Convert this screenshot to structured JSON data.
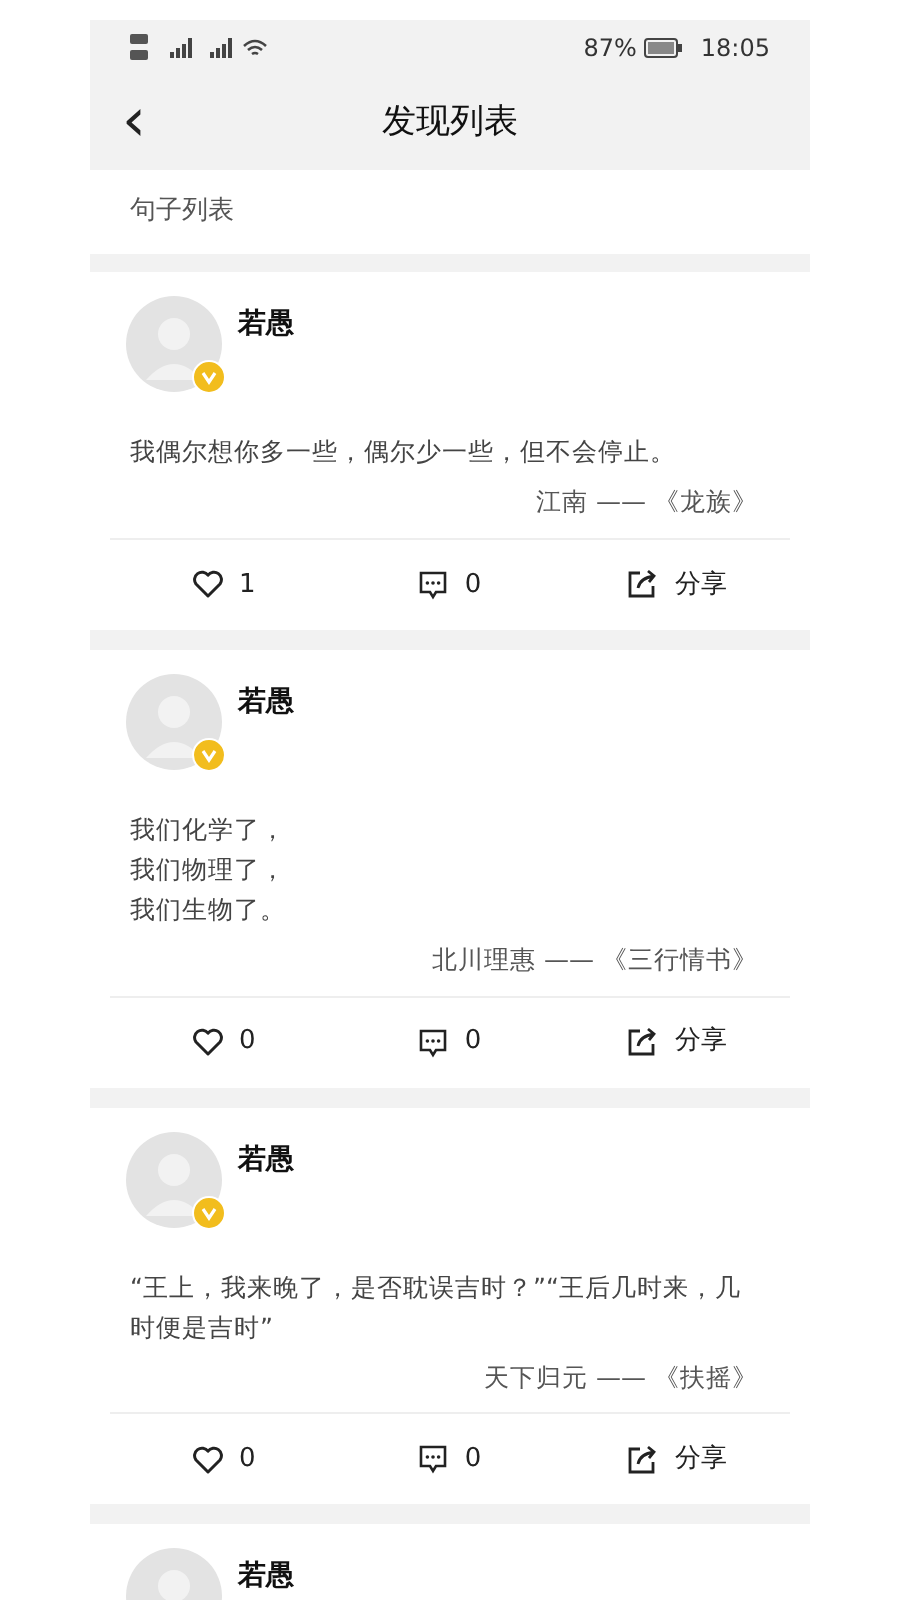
{
  "status_bar": {
    "battery": "87%",
    "time": "18:05"
  },
  "header": {
    "back": "‹",
    "title": "发现列表"
  },
  "section_title": "句子列表",
  "cards": [
    {
      "name": "若愚",
      "verified": true,
      "quote": "我偶尔想你多一些，偶尔少一些，但不会停止。",
      "source": "江南 —— 《龙族》",
      "likes": "1",
      "comments": "0",
      "share": "分享"
    },
    {
      "name": "若愚",
      "verified": true,
      "quote_lines": [
        "我们化学了，",
        "我们物理了，",
        "我们生物了。"
      ],
      "source": "北川理惠 —— 《三行情书》",
      "likes": "0",
      "comments": "0",
      "share": "分享"
    },
    {
      "name": "若愚",
      "verified": true,
      "quote": "“王上，我来晚了，是否耽误吉时？”“王后几时来，几时便是吉时”",
      "source": "天下归元 —— 《扶摇》",
      "likes": "0",
      "comments": "0",
      "share": "分享"
    },
    {
      "name": "若愚"
    }
  ]
}
